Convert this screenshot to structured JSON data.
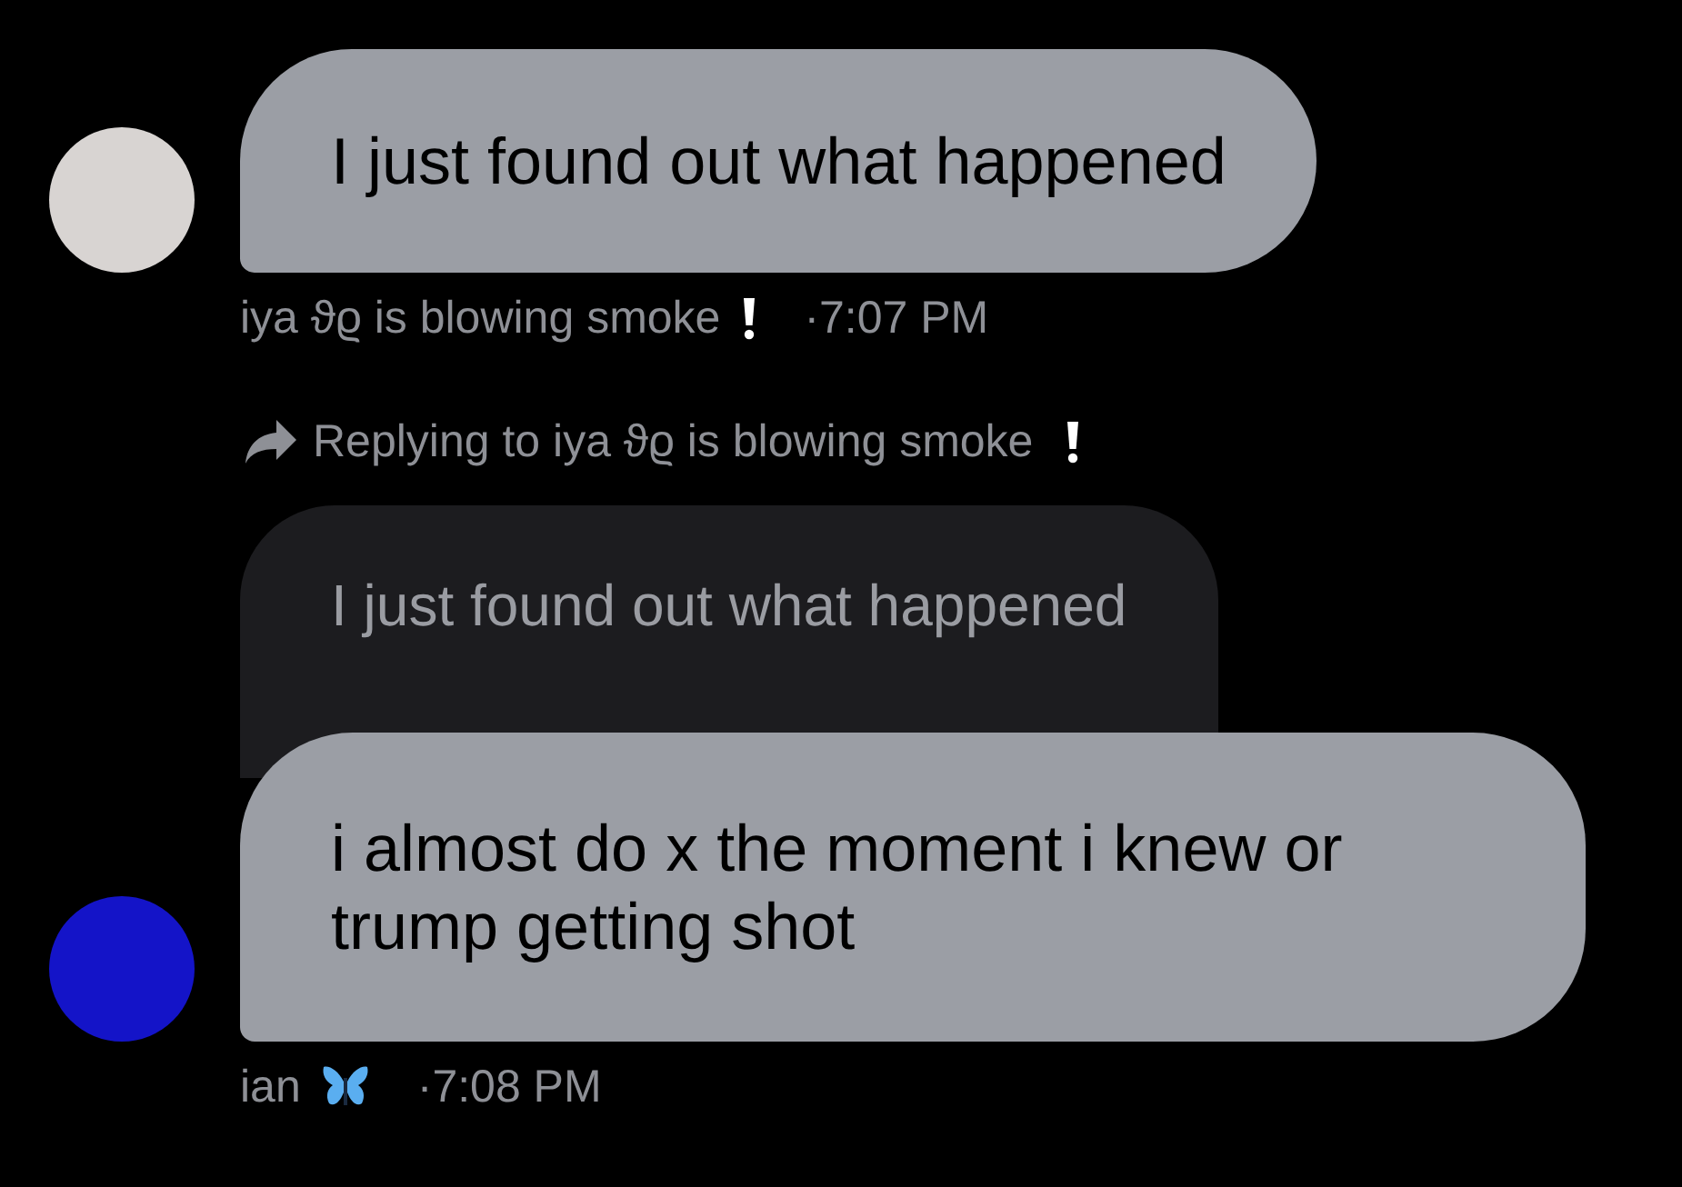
{
  "messages": [
    {
      "author": "iya ϑϱ is blowing smoke",
      "badge": {
        "kind": "exclamation"
      },
      "time": "·7:07 PM",
      "color": "#d8d4d2",
      "text": "I just found out what happened"
    },
    {
      "author": "ian",
      "badge": {
        "kind": "butterfly"
      },
      "time": "·7:08 PM",
      "color": "#1414c8",
      "text": "i almost do x the moment i knew or\ntrump getting shot",
      "reply_to": {
        "label": "Replying to iya ϑϱ is blowing smoke",
        "badge": {
          "kind": "exclamation"
        },
        "quote": "I just found out what happened"
      }
    }
  ]
}
